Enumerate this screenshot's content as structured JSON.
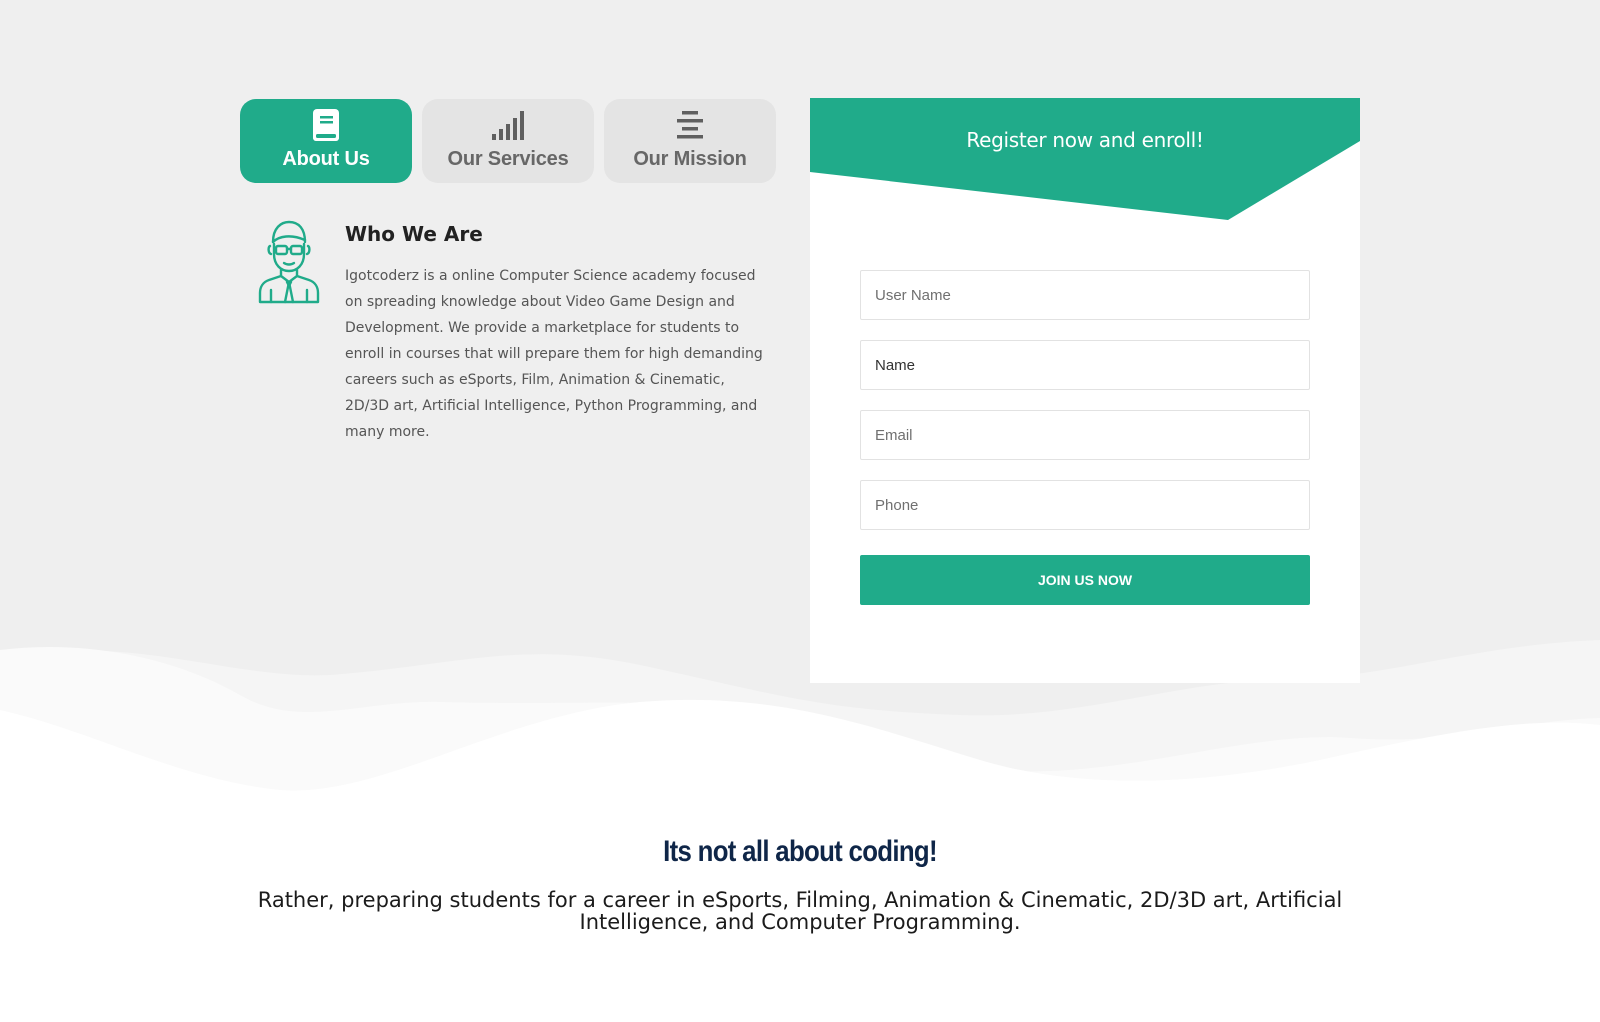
{
  "tabs": [
    {
      "label": "About Us",
      "icon": "book-icon",
      "active": true
    },
    {
      "label": "Our Services",
      "icon": "signal-bars-icon",
      "active": false
    },
    {
      "label": "Our Mission",
      "icon": "align-center-icon",
      "active": false
    }
  ],
  "about": {
    "icon": "nerd-avatar-icon",
    "title": "Who We Are",
    "text": "Igotcoderz is a online Computer Science academy focused on spreading knowledge about Video Game Design and Development. We provide a marketplace for students to enroll in courses that will prepare them for high demanding careers such as eSports, Film, Animation & Cinematic, 2D/3D art, Artificial Intelligence, Python Programming, and many more."
  },
  "register": {
    "title": "Register now and enroll!",
    "fields": {
      "username_placeholder": "User Name",
      "name_placeholder": "Name",
      "email_placeholder": "Email",
      "phone_placeholder": "Phone"
    },
    "button_label": "JOIN US NOW"
  },
  "bottom": {
    "title": "Its not all about coding!",
    "text": "Rather, preparing students for a career in eSports, Filming, Animation & Cinematic, 2D/3D art, Artificial Intelligence, and Computer Programming."
  },
  "colors": {
    "accent": "#20ab8a",
    "background": "#efefef",
    "tab_inactive": "#e4e4e4",
    "heading_navy": "#0f2648"
  }
}
